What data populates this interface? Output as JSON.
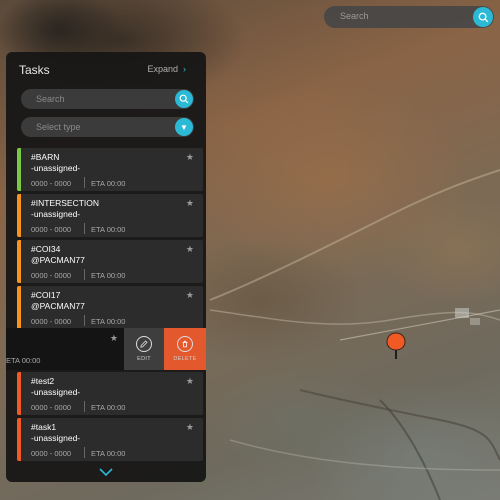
{
  "top_search": {
    "placeholder": "Search"
  },
  "panel": {
    "title": "Tasks",
    "expand_label": "Expand",
    "search_placeholder": "Search",
    "type_placeholder": "Select type"
  },
  "tasks": [
    {
      "name": "#BARN",
      "assignee": "-unassigned-",
      "code": "0000 - 0000",
      "eta": "ETA 00:00",
      "color": "#7ac943"
    },
    {
      "name": "#INTERSECTION",
      "assignee": "-unassigned-",
      "code": "0000 - 0000",
      "eta": "ETA 00:00",
      "color": "#f7931e"
    },
    {
      "name": "#COI34",
      "assignee": "@PACMAN77",
      "code": "0000 - 0000",
      "eta": "ETA 00:00",
      "color": "#f7931e"
    },
    {
      "name": "#COI17",
      "assignee": "@PACMAN77",
      "code": "0000 - 0000",
      "eta": "ETA 00:00",
      "color": "#f7931e"
    }
  ],
  "swiped_task": {
    "eta": "ETA 00:00",
    "edit_label": "EDIT",
    "delete_label": "DELETE"
  },
  "tasks_bottom": [
    {
      "name": "#test2",
      "assignee": "-unassigned-",
      "code": "0000 - 0000",
      "eta": "ETA 00:00",
      "color": "#f15a24"
    },
    {
      "name": "#task1",
      "assignee": "-unassigned-",
      "code": "0000 - 0000",
      "eta": "ETA 00:00",
      "color": "#f15a24"
    }
  ],
  "colors": {
    "accent": "#2bb9d6",
    "delete": "#e4582e",
    "marker": "#f15a24"
  }
}
